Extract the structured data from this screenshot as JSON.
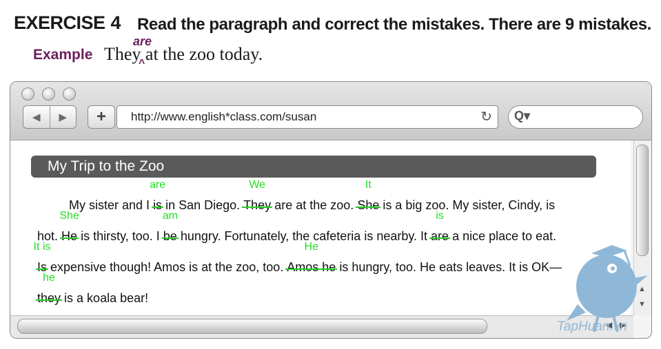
{
  "exercise": {
    "title": "EXERCISE",
    "number": "4",
    "instruction": "Read the paragraph and correct the mistakes. There are 9 mistakes."
  },
  "example": {
    "label": "Example",
    "sentence_start": "They",
    "sentence_end": "at the zoo today.",
    "insert": "are",
    "caret": "^"
  },
  "browser": {
    "url": "http://www.english*class.com/susan",
    "back_icon": "◀",
    "forward_icon": "▶",
    "plus_icon": "+",
    "reload_icon": "↻",
    "search_icon": "Q▾"
  },
  "page": {
    "heading": "My Trip to the Zoo",
    "line1": {
      "a": "My sister and I",
      "del1": "is",
      "fix1": "are",
      "b": "in San Diego.",
      "del2": "They",
      "fix2": "We",
      "c": "are at the zoo.",
      "del3": "She",
      "fix3": "It",
      "d": "is a big zoo. My sister, Cindy, is"
    },
    "line2": {
      "a": "hot.",
      "del1": "He",
      "fix1": "She",
      "b": "is thirsty, too. I",
      "del2": "be",
      "fix2": "am",
      "c": "hungry. Fortunately, the cafeteria is nearby. It",
      "del3": "are",
      "fix3": "is",
      "d": "a nice place to eat."
    },
    "line3": {
      "del1": "Is",
      "fix1": "It is",
      "a": "expensive though! Amos is at the zoo, too.",
      "del2": "Amos he",
      "fix2": "He",
      "b": "is hungry, too. He eats leaves. It is OK—"
    },
    "line4": {
      "del1": "they",
      "fix1": "he",
      "a": "is a koala bear!"
    }
  },
  "watermark": "TapHuan.vn",
  "colors": {
    "correction": "#22dd22",
    "example_accent": "#6b1f5f",
    "banner": "#5a5a5a",
    "logo": "#8fb8d8"
  }
}
